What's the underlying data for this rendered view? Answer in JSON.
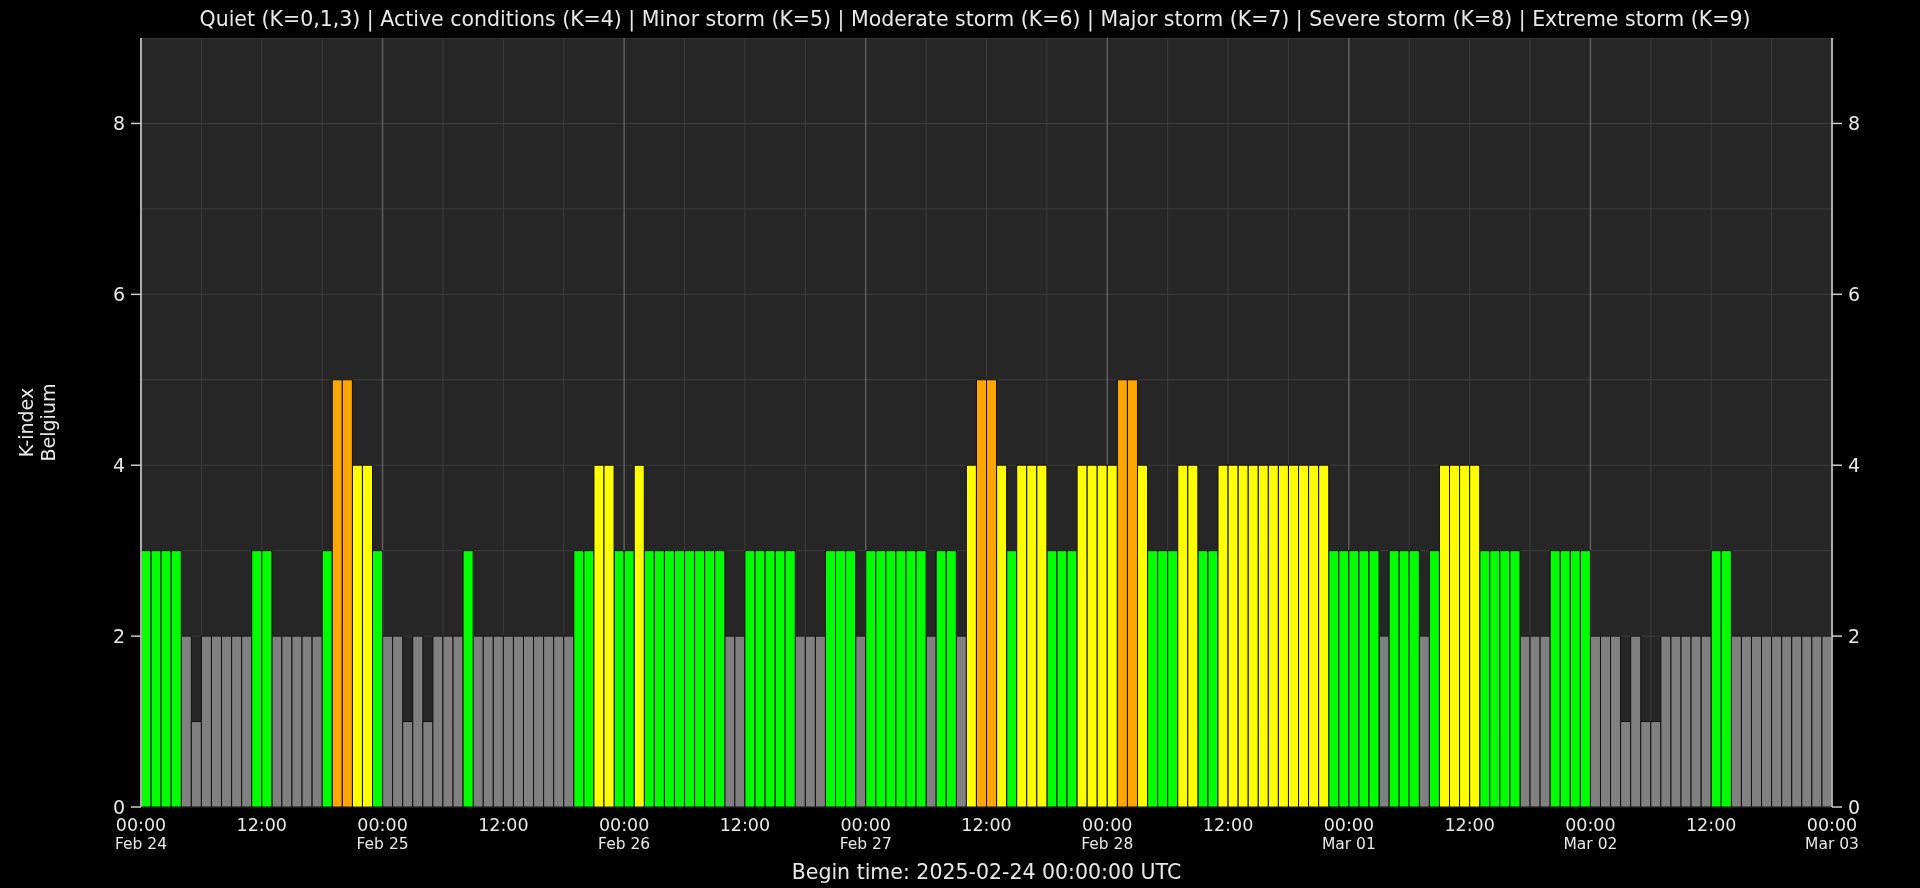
{
  "title": "Quiet (K=0,1,3) | Active conditions (K=4) | Minor storm (K=5) | Moderate storm (K=6) | Major storm (K=7) | Severe storm (K=8) | Extreme storm (K=9)",
  "chart_data": {
    "type": "bar",
    "ylabel": "K-index\nBelgium",
    "xlabel": "Begin time: 2025-02-24 00:00:00 UTC",
    "grid": true,
    "ylim": [
      0,
      9
    ],
    "yticks": [
      0,
      2,
      4,
      6,
      8
    ],
    "categories": [
      "00:00\nFeb 24",
      null,
      null,
      null,
      null,
      null,
      null,
      null,
      null,
      null,
      null,
      null,
      "12:00",
      null,
      null,
      null,
      null,
      null,
      null,
      null,
      null,
      null,
      null,
      null,
      "00:00\nFeb 25",
      null,
      null,
      null,
      null,
      null,
      null,
      null,
      null,
      null,
      null,
      null,
      "12:00",
      null,
      null,
      null,
      null,
      null,
      null,
      null,
      null,
      null,
      null,
      null,
      "00:00\nFeb 26",
      null,
      null,
      null,
      null,
      null,
      null,
      null,
      null,
      null,
      null,
      null,
      "12:00",
      null,
      null,
      null,
      null,
      null,
      null,
      null,
      null,
      null,
      null,
      null,
      "00:00\nFeb 27",
      null,
      null,
      null,
      null,
      null,
      null,
      null,
      null,
      null,
      null,
      null,
      "12:00",
      null,
      null,
      null,
      null,
      null,
      null,
      null,
      null,
      null,
      null,
      null,
      "00:00\nFeb 28",
      null,
      null,
      null,
      null,
      null,
      null,
      null,
      null,
      null,
      null,
      null,
      "12:00",
      null,
      null,
      null,
      null,
      null,
      null,
      null,
      null,
      null,
      null,
      null,
      "00:00\nMar 01",
      null,
      null,
      null,
      null,
      null,
      null,
      null,
      null,
      null,
      null,
      null,
      "12:00",
      null,
      null,
      null,
      null,
      null,
      null,
      null,
      null,
      null,
      null,
      null,
      "00:00\nMar 02",
      null,
      null,
      null,
      null,
      null,
      null,
      null,
      null,
      null,
      null,
      null,
      "12:00",
      null,
      null,
      null,
      null,
      null,
      null,
      null,
      null,
      null,
      null,
      null,
      "00:00\nMar 03"
    ],
    "series": [
      {
        "color": "#808080",
        "values": [
          null,
          null,
          null,
          null,
          2,
          1,
          2,
          2,
          2,
          2,
          2,
          null,
          null,
          2,
          2,
          2,
          2,
          2,
          null,
          null,
          null,
          null,
          null,
          null,
          2,
          2,
          1,
          2,
          1,
          2,
          2,
          2,
          null,
          2,
          2,
          2,
          2,
          2,
          2,
          2,
          2,
          2,
          2,
          null,
          null,
          null,
          null,
          null,
          null,
          null,
          null,
          null,
          null,
          null,
          null,
          null,
          null,
          null,
          2,
          2,
          null,
          null,
          null,
          null,
          null,
          2,
          2,
          2,
          null,
          null,
          null,
          2,
          null,
          null,
          null,
          null,
          null,
          null,
          2,
          null,
          null,
          2,
          null,
          null,
          null,
          null,
          null,
          null,
          null,
          null,
          null,
          null,
          null,
          null,
          null,
          null,
          null,
          null,
          null,
          null,
          null,
          null,
          null,
          null,
          null,
          null,
          null,
          null,
          null,
          null,
          null,
          null,
          null,
          null,
          null,
          null,
          null,
          null,
          null,
          null,
          null,
          null,
          null,
          2,
          null,
          null,
          null,
          2,
          null,
          null,
          null,
          null,
          null,
          null,
          null,
          null,
          null,
          2,
          2,
          2,
          null,
          null,
          null,
          null,
          2,
          2,
          2,
          1,
          2,
          1,
          1,
          2,
          2,
          2,
          2,
          2,
          null,
          null,
          2,
          2,
          2,
          2,
          2,
          2,
          2,
          2,
          2,
          2,
          null
        ]
      },
      {
        "color": "#00ff00",
        "values": [
          3,
          3,
          3,
          3,
          null,
          null,
          null,
          null,
          null,
          null,
          null,
          3,
          3,
          null,
          null,
          null,
          null,
          null,
          3,
          null,
          null,
          null,
          null,
          3,
          null,
          null,
          null,
          null,
          null,
          null,
          null,
          null,
          3,
          null,
          null,
          null,
          null,
          null,
          null,
          null,
          null,
          null,
          null,
          3,
          3,
          null,
          null,
          3,
          3,
          null,
          3,
          3,
          3,
          3,
          3,
          3,
          3,
          3,
          null,
          null,
          3,
          3,
          3,
          3,
          3,
          null,
          null,
          null,
          3,
          3,
          3,
          null,
          3,
          3,
          3,
          3,
          3,
          3,
          null,
          3,
          3,
          null,
          null,
          null,
          null,
          null,
          3,
          null,
          null,
          null,
          3,
          3,
          3,
          null,
          null,
          null,
          null,
          null,
          null,
          null,
          3,
          3,
          3,
          null,
          null,
          3,
          3,
          null,
          null,
          null,
          null,
          null,
          null,
          null,
          null,
          null,
          null,
          null,
          3,
          3,
          3,
          3,
          3,
          null,
          3,
          3,
          3,
          null,
          3,
          null,
          null,
          null,
          null,
          3,
          3,
          3,
          3,
          null,
          null,
          null,
          3,
          3,
          3,
          3,
          null,
          null,
          null,
          null,
          null,
          null,
          null,
          null,
          null,
          null,
          null,
          null,
          3,
          3,
          null,
          null,
          null,
          null,
          null,
          null,
          null,
          null,
          null,
          null,
          null
        ]
      },
      {
        "color": "#ffff00",
        "values": [
          null,
          null,
          null,
          null,
          null,
          null,
          null,
          null,
          null,
          null,
          null,
          null,
          null,
          null,
          null,
          null,
          null,
          null,
          null,
          null,
          null,
          4,
          4,
          null,
          null,
          null,
          null,
          null,
          null,
          null,
          null,
          null,
          null,
          null,
          null,
          null,
          null,
          null,
          null,
          null,
          null,
          null,
          null,
          null,
          null,
          4,
          4,
          null,
          null,
          4,
          null,
          null,
          null,
          null,
          null,
          null,
          null,
          null,
          null,
          null,
          null,
          null,
          null,
          null,
          null,
          null,
          null,
          null,
          null,
          null,
          null,
          null,
          null,
          null,
          null,
          null,
          null,
          null,
          null,
          null,
          null,
          null,
          4,
          null,
          null,
          4,
          null,
          4,
          4,
          4,
          null,
          null,
          null,
          4,
          4,
          4,
          4,
          null,
          null,
          4,
          null,
          null,
          null,
          4,
          4,
          null,
          null,
          4,
          4,
          4,
          4,
          4,
          4,
          4,
          4,
          4,
          4,
          4,
          null,
          null,
          null,
          null,
          null,
          null,
          null,
          null,
          null,
          null,
          null,
          4,
          4,
          4,
          4,
          null,
          null,
          null,
          null,
          null,
          null,
          null,
          null,
          null,
          null,
          null,
          null,
          null,
          null,
          null,
          null,
          null,
          null,
          null,
          null,
          null,
          null,
          null,
          null,
          null,
          null,
          null,
          null,
          null,
          null,
          null,
          null,
          null,
          null,
          null,
          null
        ]
      },
      {
        "color": "#ffa500",
        "values": [
          null,
          null,
          null,
          null,
          null,
          null,
          null,
          null,
          null,
          null,
          null,
          null,
          null,
          null,
          null,
          null,
          null,
          null,
          null,
          5,
          5,
          null,
          null,
          null,
          null,
          null,
          null,
          null,
          null,
          null,
          null,
          null,
          null,
          null,
          null,
          null,
          null,
          null,
          null,
          null,
          null,
          null,
          null,
          null,
          null,
          null,
          null,
          null,
          null,
          null,
          null,
          null,
          null,
          null,
          null,
          null,
          null,
          null,
          null,
          null,
          null,
          null,
          null,
          null,
          null,
          null,
          null,
          null,
          null,
          null,
          null,
          null,
          null,
          null,
          null,
          null,
          null,
          null,
          null,
          null,
          null,
          null,
          null,
          5,
          5,
          null,
          null,
          null,
          null,
          null,
          null,
          null,
          null,
          null,
          null,
          null,
          null,
          5,
          5,
          null,
          null,
          null,
          null,
          null,
          null,
          null,
          null,
          null,
          null,
          null,
          null,
          null,
          null,
          null,
          null,
          null,
          null,
          null,
          null,
          null,
          null,
          null,
          null,
          null,
          null,
          null,
          null,
          null,
          null,
          null,
          null,
          null,
          null,
          null,
          null,
          null,
          null,
          null,
          null,
          null,
          null,
          null,
          null,
          null,
          null,
          null,
          null,
          null,
          null,
          null,
          null,
          null,
          null,
          null,
          null,
          null,
          null,
          null,
          null,
          null,
          null,
          null,
          null,
          null,
          null,
          null,
          null,
          null,
          null
        ]
      }
    ]
  },
  "right_axis": {
    "ticks": [
      "8",
      "6",
      "4",
      "2",
      "0"
    ]
  }
}
